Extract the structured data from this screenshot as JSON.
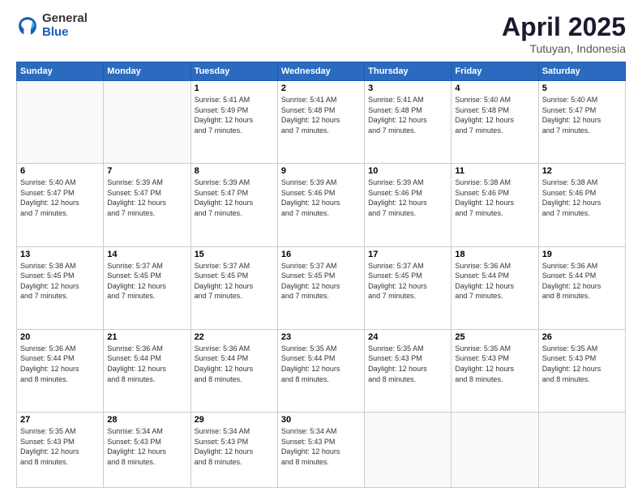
{
  "logo": {
    "general": "General",
    "blue": "Blue"
  },
  "title": {
    "month_year": "April 2025",
    "location": "Tutuyan, Indonesia"
  },
  "weekdays": [
    "Sunday",
    "Monday",
    "Tuesday",
    "Wednesday",
    "Thursday",
    "Friday",
    "Saturday"
  ],
  "weeks": [
    [
      {
        "day": null
      },
      {
        "day": null
      },
      {
        "day": "1",
        "sunrise": "5:41 AM",
        "sunset": "5:49 PM",
        "daylight": "12 hours and 7 minutes."
      },
      {
        "day": "2",
        "sunrise": "5:41 AM",
        "sunset": "5:48 PM",
        "daylight": "12 hours and 7 minutes."
      },
      {
        "day": "3",
        "sunrise": "5:41 AM",
        "sunset": "5:48 PM",
        "daylight": "12 hours and 7 minutes."
      },
      {
        "day": "4",
        "sunrise": "5:40 AM",
        "sunset": "5:48 PM",
        "daylight": "12 hours and 7 minutes."
      },
      {
        "day": "5",
        "sunrise": "5:40 AM",
        "sunset": "5:47 PM",
        "daylight": "12 hours and 7 minutes."
      }
    ],
    [
      {
        "day": "6",
        "sunrise": "5:40 AM",
        "sunset": "5:47 PM",
        "daylight": "12 hours and 7 minutes."
      },
      {
        "day": "7",
        "sunrise": "5:39 AM",
        "sunset": "5:47 PM",
        "daylight": "12 hours and 7 minutes."
      },
      {
        "day": "8",
        "sunrise": "5:39 AM",
        "sunset": "5:47 PM",
        "daylight": "12 hours and 7 minutes."
      },
      {
        "day": "9",
        "sunrise": "5:39 AM",
        "sunset": "5:46 PM",
        "daylight": "12 hours and 7 minutes."
      },
      {
        "day": "10",
        "sunrise": "5:39 AM",
        "sunset": "5:46 PM",
        "daylight": "12 hours and 7 minutes."
      },
      {
        "day": "11",
        "sunrise": "5:38 AM",
        "sunset": "5:46 PM",
        "daylight": "12 hours and 7 minutes."
      },
      {
        "day": "12",
        "sunrise": "5:38 AM",
        "sunset": "5:46 PM",
        "daylight": "12 hours and 7 minutes."
      }
    ],
    [
      {
        "day": "13",
        "sunrise": "5:38 AM",
        "sunset": "5:45 PM",
        "daylight": "12 hours and 7 minutes."
      },
      {
        "day": "14",
        "sunrise": "5:37 AM",
        "sunset": "5:45 PM",
        "daylight": "12 hours and 7 minutes."
      },
      {
        "day": "15",
        "sunrise": "5:37 AM",
        "sunset": "5:45 PM",
        "daylight": "12 hours and 7 minutes."
      },
      {
        "day": "16",
        "sunrise": "5:37 AM",
        "sunset": "5:45 PM",
        "daylight": "12 hours and 7 minutes."
      },
      {
        "day": "17",
        "sunrise": "5:37 AM",
        "sunset": "5:45 PM",
        "daylight": "12 hours and 7 minutes."
      },
      {
        "day": "18",
        "sunrise": "5:36 AM",
        "sunset": "5:44 PM",
        "daylight": "12 hours and 7 minutes."
      },
      {
        "day": "19",
        "sunrise": "5:36 AM",
        "sunset": "5:44 PM",
        "daylight": "12 hours and 8 minutes."
      }
    ],
    [
      {
        "day": "20",
        "sunrise": "5:36 AM",
        "sunset": "5:44 PM",
        "daylight": "12 hours and 8 minutes."
      },
      {
        "day": "21",
        "sunrise": "5:36 AM",
        "sunset": "5:44 PM",
        "daylight": "12 hours and 8 minutes."
      },
      {
        "day": "22",
        "sunrise": "5:36 AM",
        "sunset": "5:44 PM",
        "daylight": "12 hours and 8 minutes."
      },
      {
        "day": "23",
        "sunrise": "5:35 AM",
        "sunset": "5:44 PM",
        "daylight": "12 hours and 8 minutes."
      },
      {
        "day": "24",
        "sunrise": "5:35 AM",
        "sunset": "5:43 PM",
        "daylight": "12 hours and 8 minutes."
      },
      {
        "day": "25",
        "sunrise": "5:35 AM",
        "sunset": "5:43 PM",
        "daylight": "12 hours and 8 minutes."
      },
      {
        "day": "26",
        "sunrise": "5:35 AM",
        "sunset": "5:43 PM",
        "daylight": "12 hours and 8 minutes."
      }
    ],
    [
      {
        "day": "27",
        "sunrise": "5:35 AM",
        "sunset": "5:43 PM",
        "daylight": "12 hours and 8 minutes."
      },
      {
        "day": "28",
        "sunrise": "5:34 AM",
        "sunset": "5:43 PM",
        "daylight": "12 hours and 8 minutes."
      },
      {
        "day": "29",
        "sunrise": "5:34 AM",
        "sunset": "5:43 PM",
        "daylight": "12 hours and 8 minutes."
      },
      {
        "day": "30",
        "sunrise": "5:34 AM",
        "sunset": "5:43 PM",
        "daylight": "12 hours and 8 minutes."
      },
      {
        "day": null
      },
      {
        "day": null
      },
      {
        "day": null
      }
    ]
  ],
  "labels": {
    "sunrise": "Sunrise:",
    "sunset": "Sunset:",
    "daylight": "Daylight:"
  }
}
